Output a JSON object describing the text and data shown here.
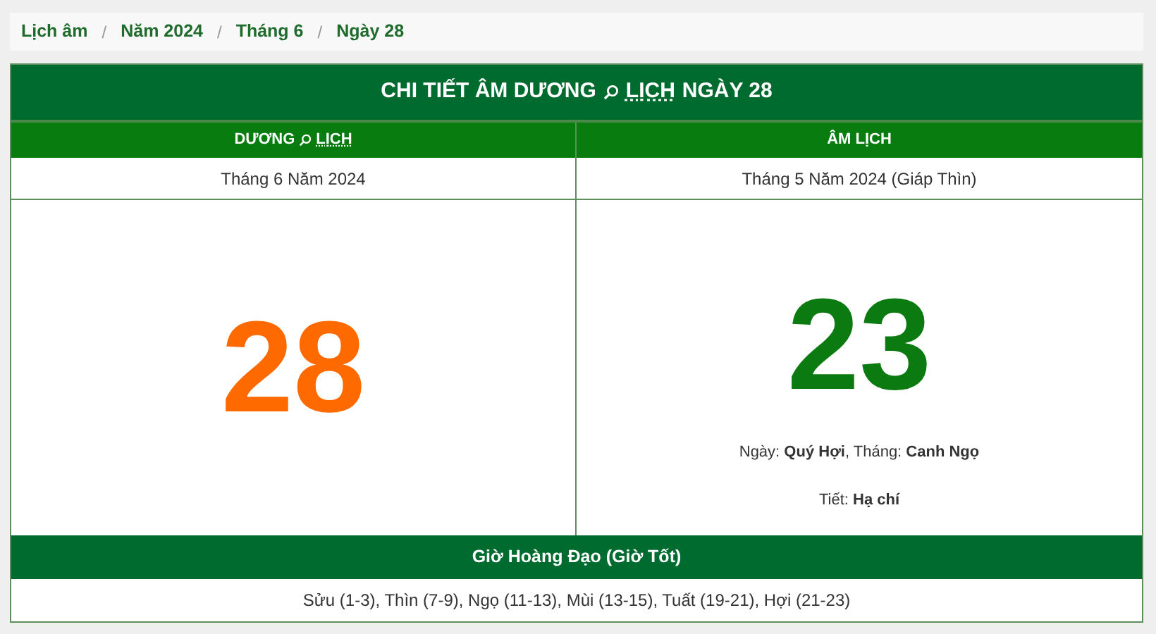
{
  "breadcrumb": [
    {
      "label": "Lịch âm"
    },
    {
      "separator": "/",
      "label": "Năm 2024"
    },
    {
      "separator": "/",
      "label": "Tháng 6"
    },
    {
      "separator": "/",
      "label": "Ngày 28"
    }
  ],
  "title": {
    "before": "CHI TIẾT ÂM DƯƠNG",
    "link": "LỊCH",
    "after": "NGÀY 28"
  },
  "solar": {
    "heading_before": "DƯƠNG",
    "heading_link": "LỊCH",
    "month": "Tháng 6 Năm 2024",
    "day": "28"
  },
  "lunar": {
    "heading": "ÂM LỊCH",
    "month": "Tháng 5 Năm 2024 (Giáp Thìn)",
    "day": "23",
    "can_chi": "Ngày: **Quý Hợi**, Tháng: **Canh Ngọ**",
    "solar_term": "Tiết: **Hạ chí**"
  },
  "good_hours": {
    "heading": "Giờ Hoàng Đạo (Giờ Tốt)",
    "hours": "Sửu (1-3), Thìn (7-9), Ngọ (11-13), Mùi (13-15), Tuất (19-21), Hợi (21-23)"
  }
}
